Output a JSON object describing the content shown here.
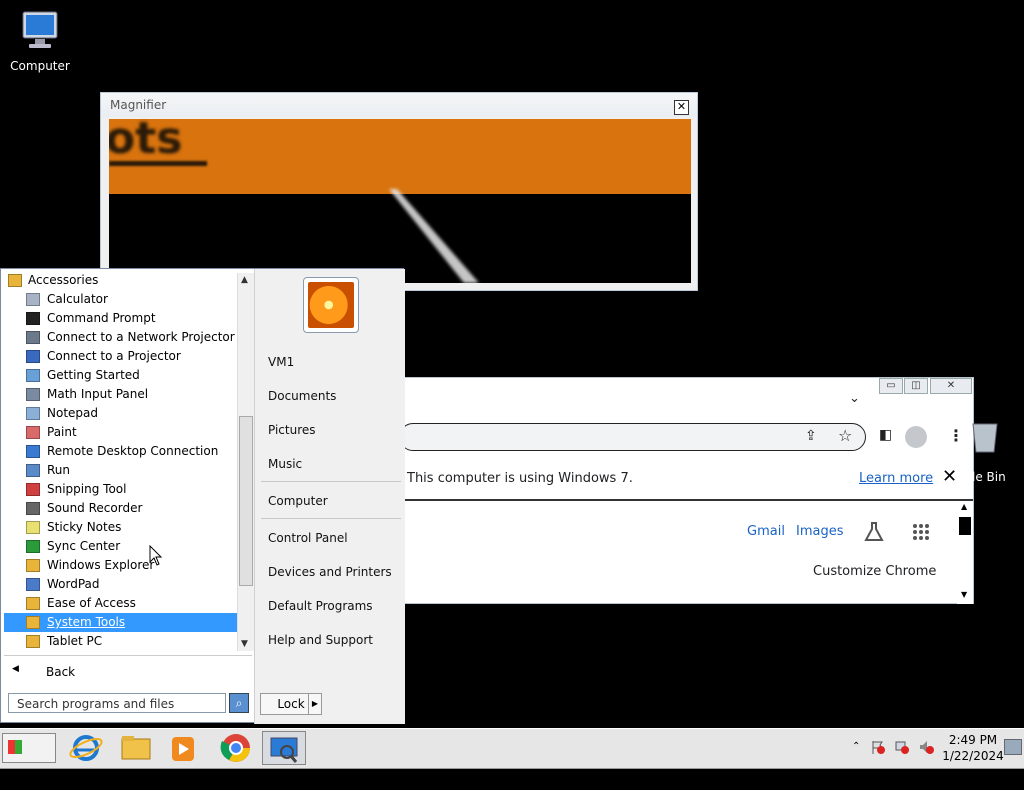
{
  "desktop": {
    "computer_label": "Computer",
    "recycle_label": "le Bin"
  },
  "magnifier": {
    "title": "Magnifier",
    "close": "✕",
    "zoomed_text": "ots"
  },
  "chrome": {
    "infobar_message": "This computer is using Windows 7.",
    "learn_more": "Learn more",
    "infobar_close": "✕",
    "gmail": "Gmail",
    "images": "Images",
    "customize": "Customize Chrome"
  },
  "start_menu": {
    "programs": [
      {
        "label": "Accessories",
        "icon": "folder-icon",
        "indent": 0
      },
      {
        "label": "Calculator",
        "icon": "calculator-icon",
        "indent": 1
      },
      {
        "label": "Command Prompt",
        "icon": "cmd-icon",
        "indent": 1
      },
      {
        "label": "Connect to a Network Projector",
        "icon": "network-projector-icon",
        "indent": 1
      },
      {
        "label": "Connect to a Projector",
        "icon": "projector-icon",
        "indent": 1
      },
      {
        "label": "Getting Started",
        "icon": "getting-started-icon",
        "indent": 1
      },
      {
        "label": "Math Input Panel",
        "icon": "math-input-icon",
        "indent": 1
      },
      {
        "label": "Notepad",
        "icon": "notepad-icon",
        "indent": 1
      },
      {
        "label": "Paint",
        "icon": "paint-icon",
        "indent": 1
      },
      {
        "label": "Remote Desktop Connection",
        "icon": "remote-desktop-icon",
        "indent": 1
      },
      {
        "label": "Run",
        "icon": "run-icon",
        "indent": 1
      },
      {
        "label": "Snipping Tool",
        "icon": "snipping-tool-icon",
        "indent": 1
      },
      {
        "label": "Sound Recorder",
        "icon": "microphone-icon",
        "indent": 1
      },
      {
        "label": "Sticky Notes",
        "icon": "sticky-notes-icon",
        "indent": 1
      },
      {
        "label": "Sync Center",
        "icon": "sync-icon",
        "indent": 1
      },
      {
        "label": "Windows Explorer",
        "icon": "explorer-icon",
        "indent": 1
      },
      {
        "label": "WordPad",
        "icon": "wordpad-icon",
        "indent": 1
      },
      {
        "label": "Ease of Access",
        "icon": "folder-icon",
        "indent": 1
      },
      {
        "label": "System Tools",
        "icon": "folder-icon",
        "indent": 1,
        "selected": true
      },
      {
        "label": "Tablet PC",
        "icon": "folder-icon",
        "indent": 1
      }
    ],
    "back_label": "Back",
    "search_placeholder": "Search programs and files",
    "right_items": [
      "VM1",
      "Documents",
      "Pictures",
      "Music",
      "Computer",
      "Control Panel",
      "Devices and Printers",
      "Default Programs",
      "Help and Support"
    ],
    "lock_label": "Lock"
  },
  "taskbar": {
    "start_label": "Start",
    "time": "2:49 PM",
    "date": "1/22/2024"
  },
  "colors": {
    "selection": "#3399ff",
    "link": "#1a62c5",
    "magnifier_orange": "#d8730e"
  }
}
